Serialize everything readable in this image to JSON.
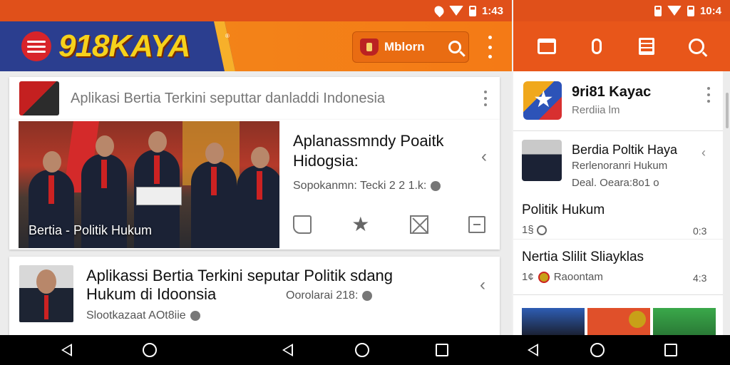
{
  "status_left": {
    "time": "1:43"
  },
  "status_right": {
    "time": "10:4"
  },
  "brand": {
    "name": "918KAYA",
    "mark": "®"
  },
  "search": {
    "label": "Mblorn"
  },
  "header_card": {
    "text": "Aplikasi Bertia Terkini seputtar danladdi Indonesia"
  },
  "feature": {
    "caption": "Bertia - Politik Hukum",
    "title": "Aplanassmndy Poaitk Hidogsia:",
    "meta": "Sopokanmn: Tecki 2 2 1.k:",
    "share_glyph": "‹"
  },
  "article": {
    "title": "Aplikassi Bertia Terkini seputar Politik sdang Hukum di Idoonsia",
    "meta": "Oorolarai 218:",
    "meta2": "Slootkazaat AOt8iie",
    "share_glyph": "‹"
  },
  "side": {
    "app_name": "9ri81 Kayac",
    "app_sub": "Rerdiia lm",
    "item1": {
      "title": "Berdia Poltik Haya",
      "sub": "Rerlenoranri Hukum",
      "sub2": "Deal. Oeara:8o1 o"
    },
    "item2": {
      "title": "Politik Hukum",
      "count": "1§",
      "time": "0:3"
    },
    "item3": {
      "title": "Nertia Slilit Sliayklas",
      "count": "1¢",
      "meta": "Raoontam",
      "time": "4:3"
    }
  }
}
